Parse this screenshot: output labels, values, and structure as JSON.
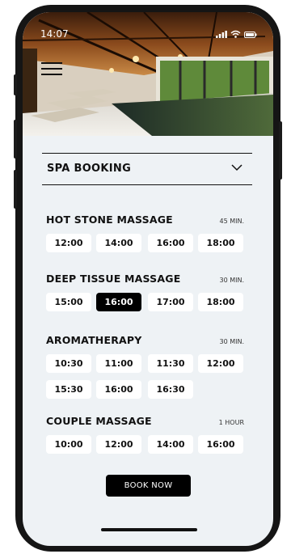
{
  "status": {
    "time": "14:07"
  },
  "booking": {
    "title": "SPA BOOKING"
  },
  "services": [
    {
      "name": "HOT STONE MASSAGE",
      "duration": "45 MIN.",
      "slots": [
        "12:00",
        "14:00",
        "16:00",
        "18:00"
      ],
      "selected": null
    },
    {
      "name": "DEEP TISSUE MASSAGE",
      "duration": "30 MIN.",
      "slots": [
        "15:00",
        "16:00",
        "17:00",
        "18:00"
      ],
      "selected": "16:00"
    },
    {
      "name": "AROMATHERAPY",
      "duration": "30 MIN.",
      "slots": [
        "10:30",
        "11:00",
        "11:30",
        "12:00",
        "15:30",
        "16:00",
        "16:30"
      ],
      "selected": null
    },
    {
      "name": "COUPLE MASSAGE",
      "duration": "1 HOUR",
      "slots": [
        "10:00",
        "12:00",
        "14:00",
        "16:00"
      ],
      "selected": null
    }
  ],
  "book_button": {
    "label": "BOOK NOW"
  },
  "colors": {
    "background": "#eef2f5",
    "slot": "#ffffff",
    "selected": "#000000",
    "accent": "#000000"
  }
}
